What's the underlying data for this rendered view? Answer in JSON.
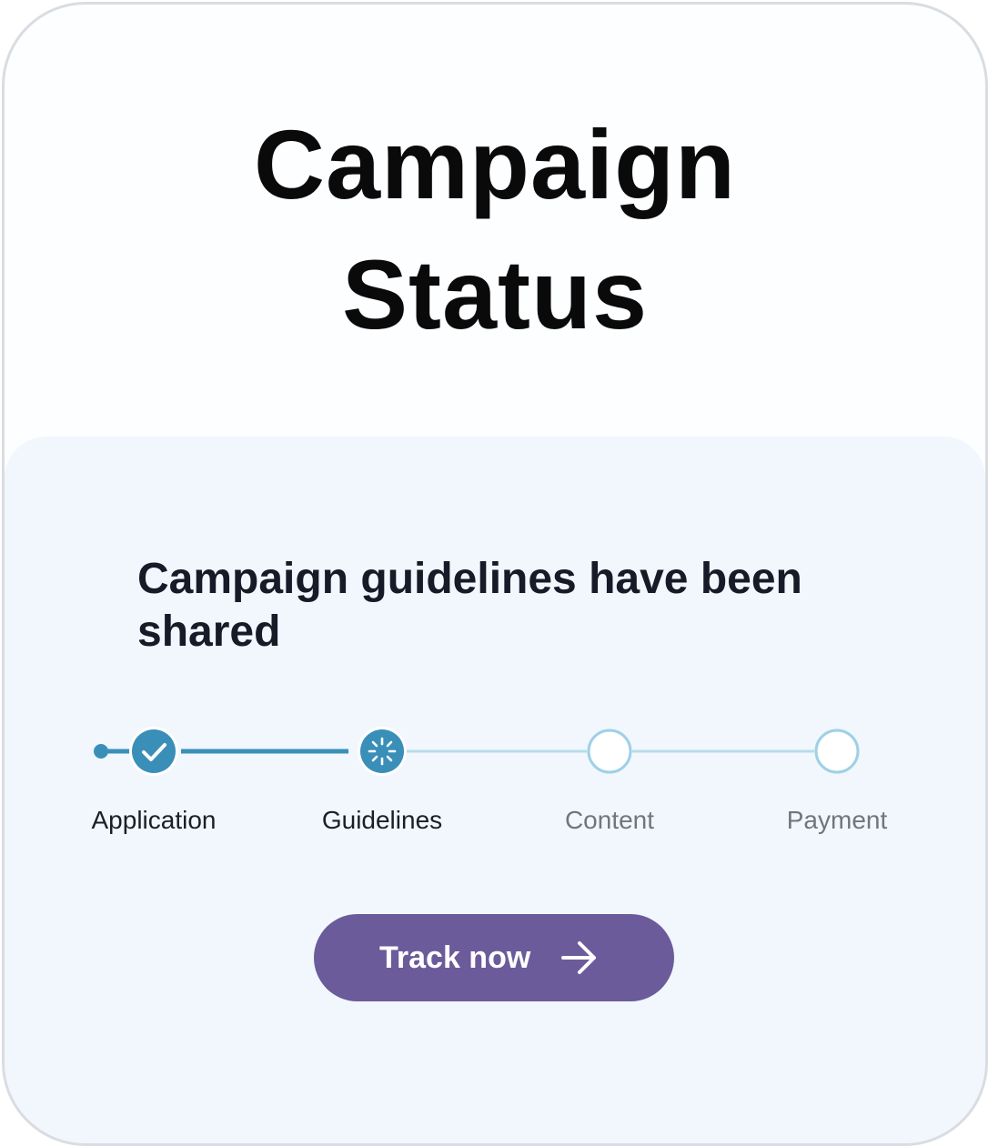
{
  "card": {
    "title_line1": "Campaign",
    "title_line2": "Status"
  },
  "status": {
    "message": "Campaign guidelines have been shared"
  },
  "steps": [
    {
      "label": "Application",
      "state": "completed",
      "icon": "check-icon"
    },
    {
      "label": "Guidelines",
      "state": "in-progress",
      "icon": "spinner-icon"
    },
    {
      "label": "Content",
      "state": "pending",
      "icon": "empty-circle-icon"
    },
    {
      "label": "Payment",
      "state": "pending",
      "icon": "empty-circle-icon"
    }
  ],
  "cta": {
    "label": "Track now",
    "icon": "arrow-right-icon"
  },
  "colors": {
    "accent_blue": "#3a8fb9",
    "pending_line": "#b8dcec",
    "button_purple": "#6b5b9a",
    "panel_bg": "#f1f7fc"
  }
}
